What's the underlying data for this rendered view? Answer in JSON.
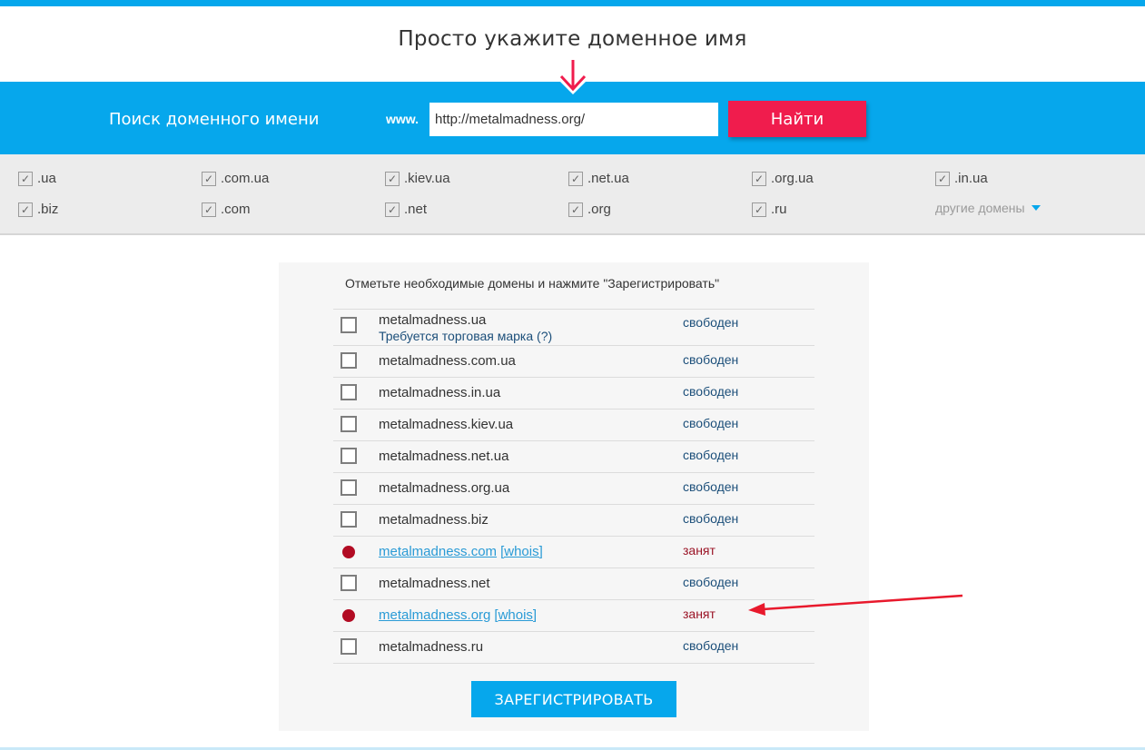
{
  "header": {
    "title": "Просто укажите доменное имя"
  },
  "search": {
    "label": "Поиск доменного имени",
    "prefix": "www.",
    "value": "http://metalmadness.org/",
    "button_label": "Найти"
  },
  "zones": {
    "items": [
      {
        "label": ".ua",
        "checked": true
      },
      {
        "label": ".com.ua",
        "checked": true
      },
      {
        "label": ".kiev.ua",
        "checked": true
      },
      {
        "label": ".net.ua",
        "checked": true
      },
      {
        "label": ".org.ua",
        "checked": true
      },
      {
        "label": ".in.ua",
        "checked": true
      },
      {
        "label": ".biz",
        "checked": true
      },
      {
        "label": ".com",
        "checked": true
      },
      {
        "label": ".net",
        "checked": true
      },
      {
        "label": ".org",
        "checked": true
      },
      {
        "label": ".ru",
        "checked": true
      }
    ],
    "other_label": "другие домены"
  },
  "results": {
    "instruction": "Отметьте необходимые домены и нажмите \"Зарегистрировать\"",
    "rows": [
      {
        "domain": "metalmadness.ua",
        "status": "свободен",
        "available": true,
        "note": "Требуется торговая марка (?)"
      },
      {
        "domain": "metalmadness.com.ua",
        "status": "свободен",
        "available": true
      },
      {
        "domain": "metalmadness.in.ua",
        "status": "свободен",
        "available": true
      },
      {
        "domain": "metalmadness.kiev.ua",
        "status": "свободен",
        "available": true
      },
      {
        "domain": "metalmadness.net.ua",
        "status": "свободен",
        "available": true
      },
      {
        "domain": "metalmadness.org.ua",
        "status": "свободен",
        "available": true
      },
      {
        "domain": "metalmadness.biz",
        "status": "свободен",
        "available": true
      },
      {
        "domain": "metalmadness.com",
        "status": "занят",
        "available": false,
        "whois": "[whois]"
      },
      {
        "domain": "metalmadness.net",
        "status": "свободен",
        "available": true
      },
      {
        "domain": "metalmadness.org",
        "status": "занят",
        "available": false,
        "whois": "[whois]"
      },
      {
        "domain": "metalmadness.ru",
        "status": "свободен",
        "available": true
      }
    ],
    "register_label": "ЗАРЕГИСТРИРОВАТЬ"
  },
  "colors": {
    "accent_blue": "#06a7ec",
    "find_button": "#f01c4d",
    "taken_dot": "#b20b23",
    "annotation_arrow": "#e8192c"
  }
}
